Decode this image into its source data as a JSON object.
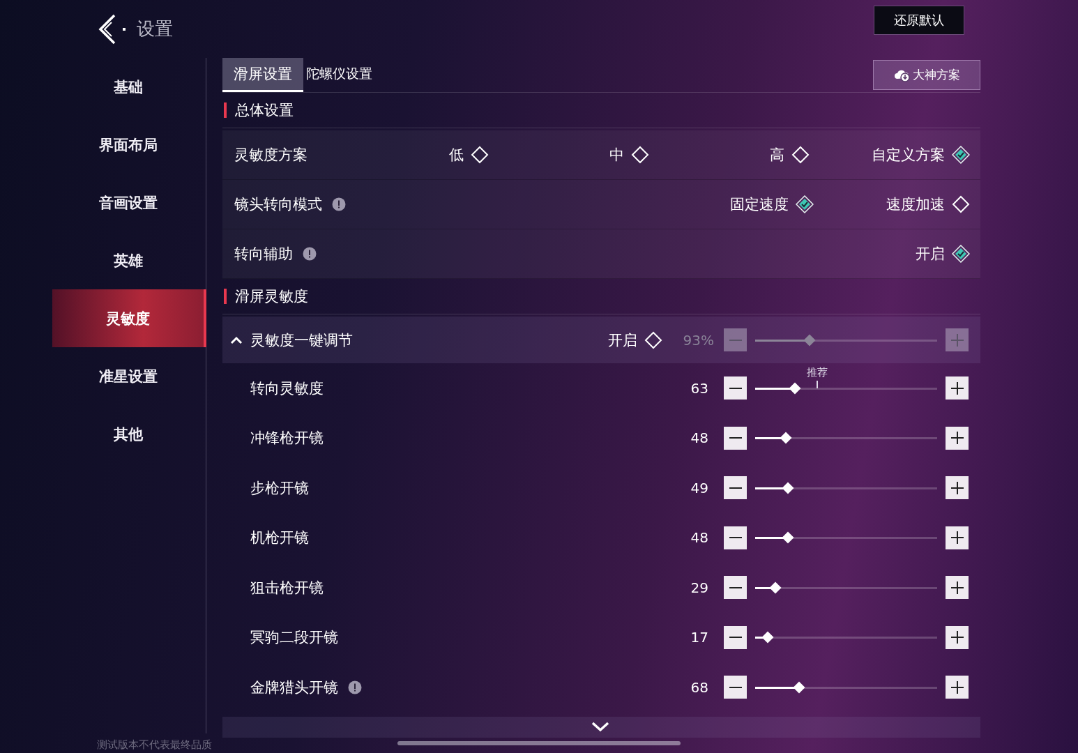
{
  "header": {
    "title": "设置",
    "reset_button": "还原默认"
  },
  "sidebar": {
    "items": [
      {
        "label": "基础",
        "selected": false
      },
      {
        "label": "界面布局",
        "selected": false
      },
      {
        "label": "音画设置",
        "selected": false
      },
      {
        "label": "英雄",
        "selected": false
      },
      {
        "label": "灵敏度",
        "selected": true
      },
      {
        "label": "准星设置",
        "selected": false
      },
      {
        "label": "其他",
        "selected": false
      }
    ]
  },
  "tabs": [
    {
      "label": "滑屏设置",
      "selected": true
    },
    {
      "label": "陀螺仪设置",
      "selected": false
    }
  ],
  "preset_button": "大神方案",
  "general": {
    "title": "总体设置",
    "rows": [
      {
        "label": "灵敏度方案",
        "options": [
          {
            "label": "低",
            "selected": false
          },
          {
            "label": "中",
            "selected": false
          },
          {
            "label": "高",
            "selected": false
          },
          {
            "label": "自定义方案",
            "selected": true
          }
        ]
      },
      {
        "label": "镜头转向模式",
        "info": true,
        "options": [
          {
            "label": "固定速度",
            "selected": true
          },
          {
            "label": "速度加速",
            "selected": false
          }
        ]
      },
      {
        "label": "转向辅助",
        "info": true,
        "options": [
          {
            "label": "开启",
            "selected": true
          }
        ]
      }
    ]
  },
  "sensitivity": {
    "title": "滑屏灵敏度",
    "master": {
      "label": "灵敏度一键调节",
      "expanded": true,
      "toggle": {
        "label": "开启",
        "selected": false
      },
      "value": "93%",
      "level": 0.3,
      "disabled": true
    },
    "sliders": [
      {
        "label": "转向灵敏度",
        "value": "63",
        "level": 0.22,
        "recommend_label": "推荐"
      },
      {
        "label": "冲锋枪开镜",
        "value": "48",
        "level": 0.17
      },
      {
        "label": "步枪开镜",
        "value": "49",
        "level": 0.18
      },
      {
        "label": "机枪开镜",
        "value": "48",
        "level": 0.18
      },
      {
        "label": "狙击枪开镜",
        "value": "29",
        "level": 0.11
      },
      {
        "label": "冥驹二段开镜",
        "value": "17",
        "level": 0.07
      },
      {
        "label": "金牌猎头开镜",
        "info": true,
        "value": "68",
        "level": 0.24
      }
    ]
  },
  "footer_note": "测试版本不代表最终品质"
}
